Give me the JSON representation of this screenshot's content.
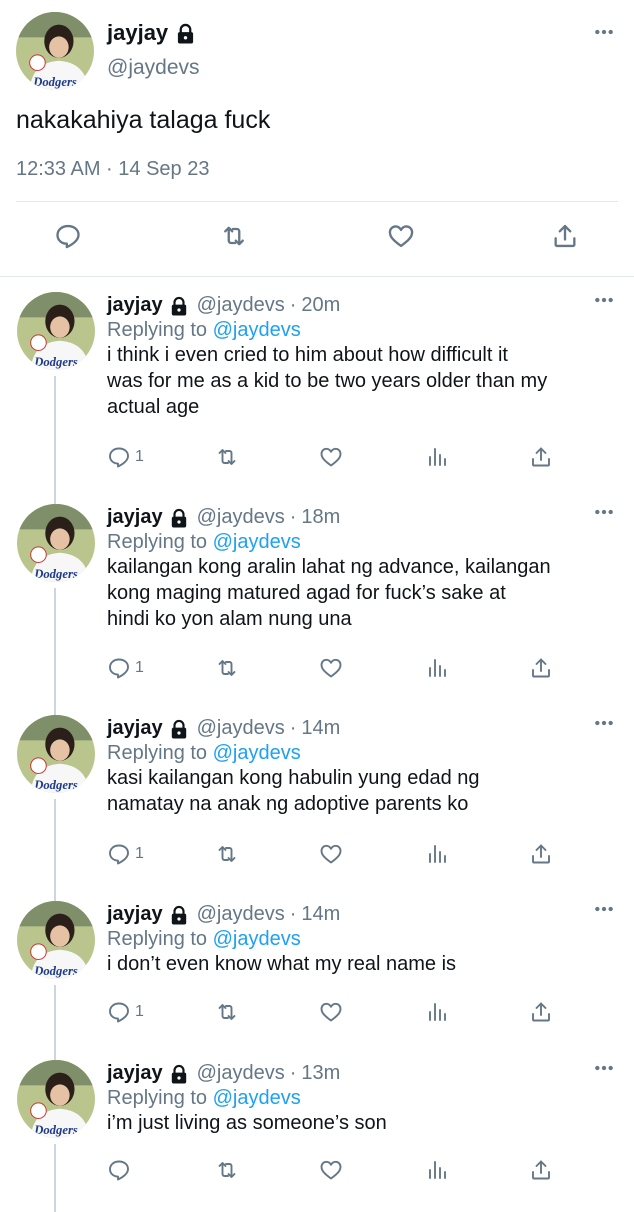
{
  "main_tweet": {
    "name": "jayjay",
    "handle": "@jaydevs",
    "text": "nakakahiya talaga fuck",
    "timestamp": "12:33 AM · 14 Sep 23"
  },
  "replies": [
    {
      "name": "jayjay",
      "handle": "@jaydevs",
      "separator": "·",
      "time": "20m",
      "replying_prefix": "Replying to",
      "replying_to": "@jaydevs",
      "lines": [
        "i think i even cried to him about how difficult it",
        "was for me as a kid to be two years older than my",
        "actual age"
      ],
      "reply_count": "1"
    },
    {
      "name": "jayjay",
      "handle": "@jaydevs",
      "separator": "·",
      "time": "18m",
      "replying_prefix": "Replying to",
      "replying_to": "@jaydevs",
      "lines": [
        "kailangan kong aralin lahat ng advance, kailangan",
        "kong maging matured agad for fuck’s sake at",
        "hindi ko yon alam nung una"
      ],
      "reply_count": "1"
    },
    {
      "name": "jayjay",
      "handle": "@jaydevs",
      "separator": "·",
      "time": "14m",
      "replying_prefix": "Replying to",
      "replying_to": "@jaydevs",
      "lines": [
        "kasi kailangan kong habulin yung edad ng",
        "namatay na anak ng adoptive parents ko"
      ],
      "reply_count": "1"
    },
    {
      "name": "jayjay",
      "handle": "@jaydevs",
      "separator": "·",
      "time": "14m",
      "replying_prefix": "Replying to",
      "replying_to": "@jaydevs",
      "lines": [
        "i don’t even know what my real name is"
      ],
      "reply_count": "1"
    },
    {
      "name": "jayjay",
      "handle": "@jaydevs",
      "separator": "·",
      "time": "13m",
      "replying_prefix": "Replying to",
      "replying_to": "@jaydevs",
      "lines": [
        "i’m just living as someone’s son"
      ],
      "reply_count": ""
    }
  ],
  "avatar_jersey_text": "Dodgers",
  "icons": {
    "lock": "lock-icon",
    "more": "more-icon",
    "reply": "reply-icon",
    "retweet": "retweet-icon",
    "like": "like-icon",
    "views": "views-icon",
    "share": "share-icon"
  },
  "colors": {
    "text": "#0f1419",
    "secondary": "#657786",
    "link": "#1da1f2",
    "border": "#e1e8ed",
    "thread_line": "#ccd6dd"
  }
}
